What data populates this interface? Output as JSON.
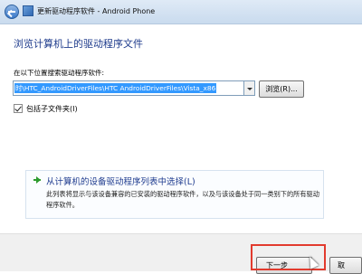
{
  "window": {
    "title": "更新驱动程序软件 - Android Phone"
  },
  "page": {
    "heading": "浏览计算机上的驱动程序文件",
    "search_label": "在以下位置搜索驱动程序软件:",
    "path_value": "时\\HTC_AndroidDriverFiles\\HTC AndroidDriverFiles\\Vista_x86",
    "browse_label": "浏览(R)...",
    "include_subfolders_label": "包括子文件夹(I)",
    "include_subfolders_checked": true
  },
  "option": {
    "title": "从计算机的设备驱动程序列表中选择(L)",
    "description": "此列表将显示与该设备兼容的已安装的驱动程序软件，以及与该设备处于同一类别下的所有驱动程序软件。"
  },
  "footer": {
    "next_label": "下一步",
    "cancel_label": "取"
  },
  "colors": {
    "heading": "#1e3b8c",
    "selection": "#3399ff",
    "highlight": "#e23b2e",
    "arrow": "#2d9b2d"
  }
}
